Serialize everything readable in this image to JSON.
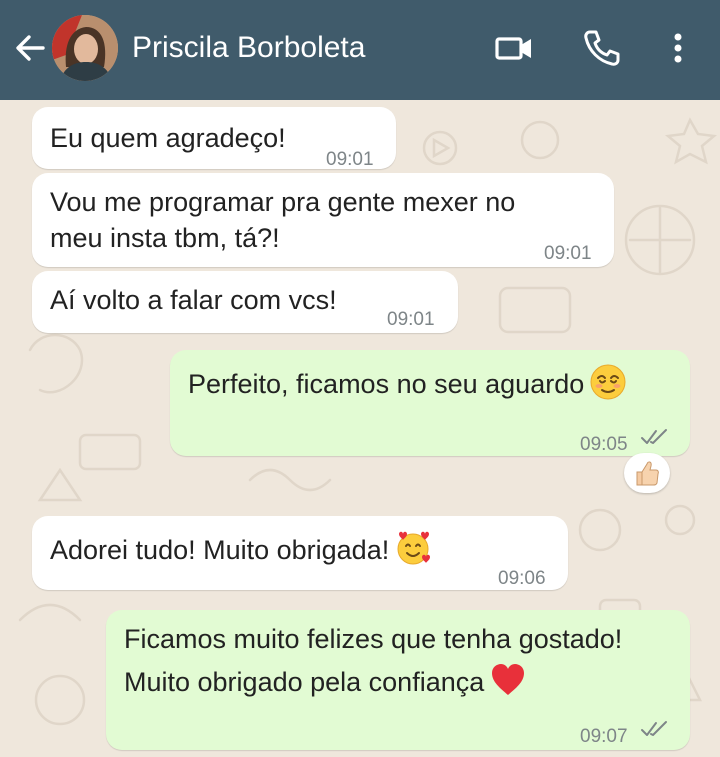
{
  "header": {
    "contact_name": "Priscila Borboleta",
    "icons": [
      "back-arrow-icon",
      "video-call-icon",
      "phone-icon",
      "more-vertical-icon"
    ],
    "color": "#405b6b"
  },
  "messages": [
    {
      "direction": "incoming",
      "text": "Eu quem agradeço!",
      "time": "09:01"
    },
    {
      "direction": "incoming",
      "lines": [
        "Vou me programar pra gente mexer no",
        "meu insta tbm,  tá?!"
      ],
      "time": "09:01"
    },
    {
      "direction": "incoming",
      "text": "Aí volto a falar com vcs!",
      "time": "09:01"
    },
    {
      "direction": "outgoing",
      "text": "Perfeito, ficamos no seu aguardo",
      "emoji": "relieved-face-emoji",
      "time": "09:05",
      "status": "read-double-check",
      "reaction": "thumbs-up-emoji"
    },
    {
      "direction": "incoming",
      "text": "Adorei tudo! Muito obrigada!",
      "emoji": "smiling-face-with-hearts-emoji",
      "time": "09:06"
    },
    {
      "direction": "outgoing",
      "lines": [
        "Ficamos muito felizes que tenha gostado!",
        "Muito obrigado pela confiança"
      ],
      "emoji": "red-heart-emoji",
      "time": "09:07",
      "status": "read-double-check"
    }
  ],
  "colors": {
    "incoming_bubble": "#ffffff",
    "outgoing_bubble": "#e2fbd3",
    "wallpaper": "#efe7dc"
  }
}
